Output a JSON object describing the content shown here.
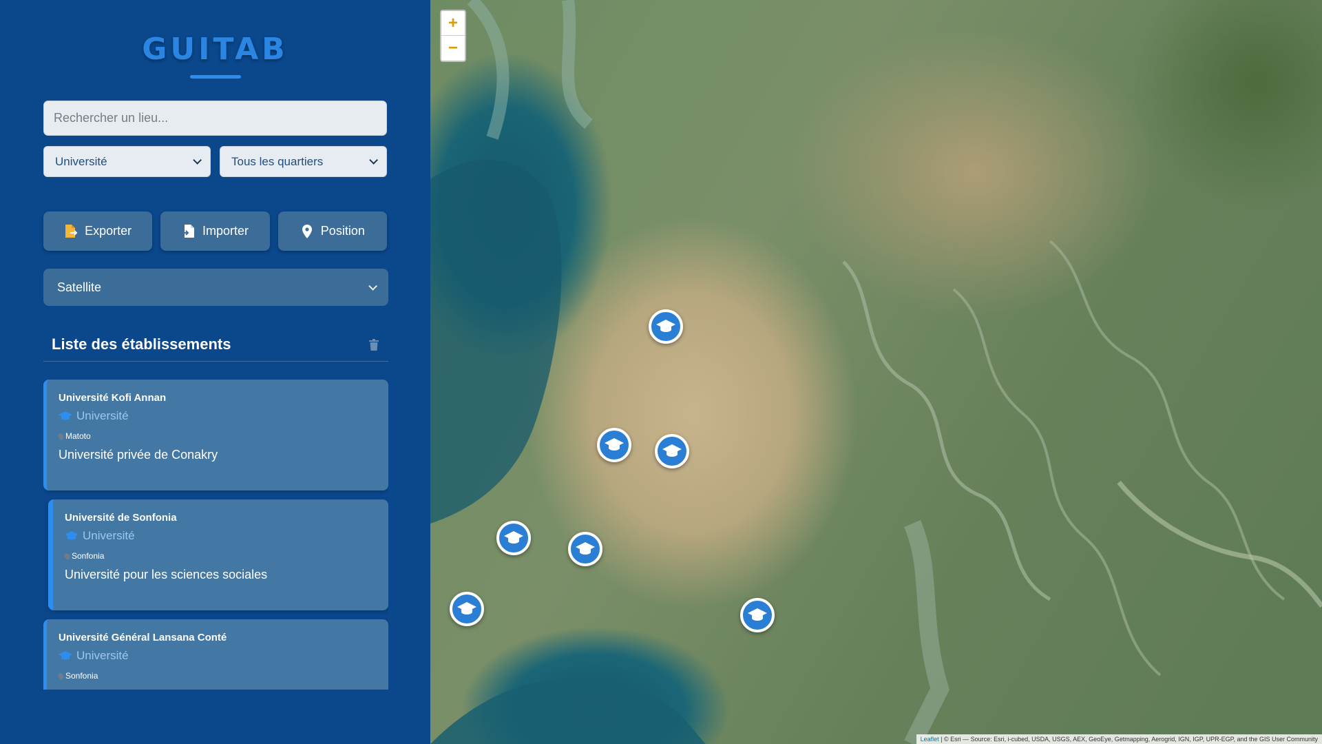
{
  "app": {
    "title": "GUITAB"
  },
  "search": {
    "placeholder": "Rechercher un lieu..."
  },
  "filters": {
    "category": "Université",
    "quarter": "Tous les quartiers"
  },
  "actions": {
    "export_label": "Exporter",
    "import_label": "Importer",
    "position_label": "Position"
  },
  "layer": {
    "selected": "Satellite"
  },
  "list": {
    "title": "Liste des établissements",
    "items": [
      {
        "name": "Université Kofi Annan",
        "type": "Université",
        "location": "Matoto",
        "description": "Université privée de Conakry"
      },
      {
        "name": "Université de Sonfonia",
        "type": "Université",
        "location": "Sonfonia",
        "description": "Université pour les sciences sociales"
      },
      {
        "name": "Université Général Lansana Conté",
        "type": "Université",
        "location": "Sonfonia",
        "description": ""
      }
    ]
  },
  "map": {
    "zoom_in": "+",
    "zoom_out": "−",
    "attribution_leaflet": "Leaflet",
    "attribution_text": "| © Esri — Source: Esri, i-cubed, USDA, USGS, AEX, GeoEye, Getmapping, Aerogrid, IGN, IGP, UPR-EGP, and the GIS User Community",
    "marker_icon": "graduation-cap-icon"
  },
  "colors": {
    "sidebar": "#0a478b",
    "accent": "#2d8ef0",
    "button": "#3c6d99"
  }
}
